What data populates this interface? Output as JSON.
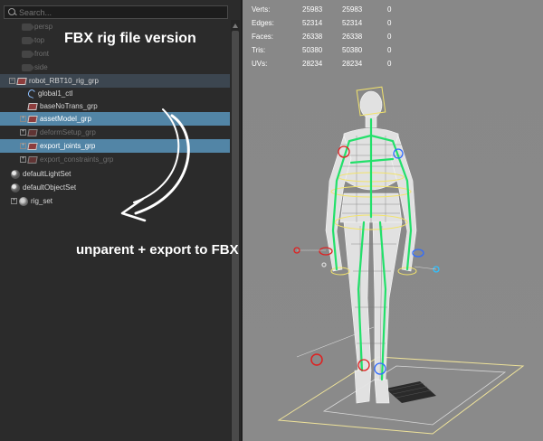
{
  "outliner": {
    "search_placeholder": "Search...",
    "items": [
      {
        "label": "persp",
        "type": "camera",
        "dim": true
      },
      {
        "label": "top",
        "type": "camera",
        "dim": true
      },
      {
        "label": "front",
        "type": "camera",
        "dim": true
      },
      {
        "label": "side",
        "type": "camera",
        "dim": true
      },
      {
        "label": "robot_RBT10_rig_grp",
        "type": "group",
        "expander": "−"
      },
      {
        "label": "global1_ctl",
        "type": "curve"
      },
      {
        "label": "baseNoTrans_grp",
        "type": "group"
      },
      {
        "label": "assetModel_grp",
        "type": "group",
        "expander": "+",
        "selected": true
      },
      {
        "label": "deformSetup_grp",
        "type": "group",
        "expander": "+",
        "dim": true
      },
      {
        "label": "export_joints_grp",
        "type": "group",
        "expander": "+",
        "selected": true
      },
      {
        "label": "export_constraints_grp",
        "type": "group",
        "expander": "+",
        "dim": true
      },
      {
        "label": "defaultLightSet",
        "type": "set"
      },
      {
        "label": "defaultObjectSet",
        "type": "set"
      },
      {
        "label": "rig_set",
        "type": "set",
        "expander": "+"
      }
    ]
  },
  "annotations": {
    "title": "FBX rig file version",
    "note": "unparent + export to FBX"
  },
  "hud": {
    "rows": [
      {
        "key": "Verts:",
        "a": "25983",
        "b": "25983",
        "c": "0"
      },
      {
        "key": "Edges:",
        "a": "52314",
        "b": "52314",
        "c": "0"
      },
      {
        "key": "Faces:",
        "a": "26338",
        "b": "26338",
        "c": "0"
      },
      {
        "key": "Tris:",
        "a": "50380",
        "b": "50380",
        "c": "0"
      },
      {
        "key": "UVs:",
        "a": "28234",
        "b": "28234",
        "c": "0"
      }
    ]
  },
  "colors": {
    "selection": "#5285a6",
    "viewport_bg": "#888888",
    "joint_green": "#22e06a",
    "ctl_yellow": "#f2e36b"
  }
}
